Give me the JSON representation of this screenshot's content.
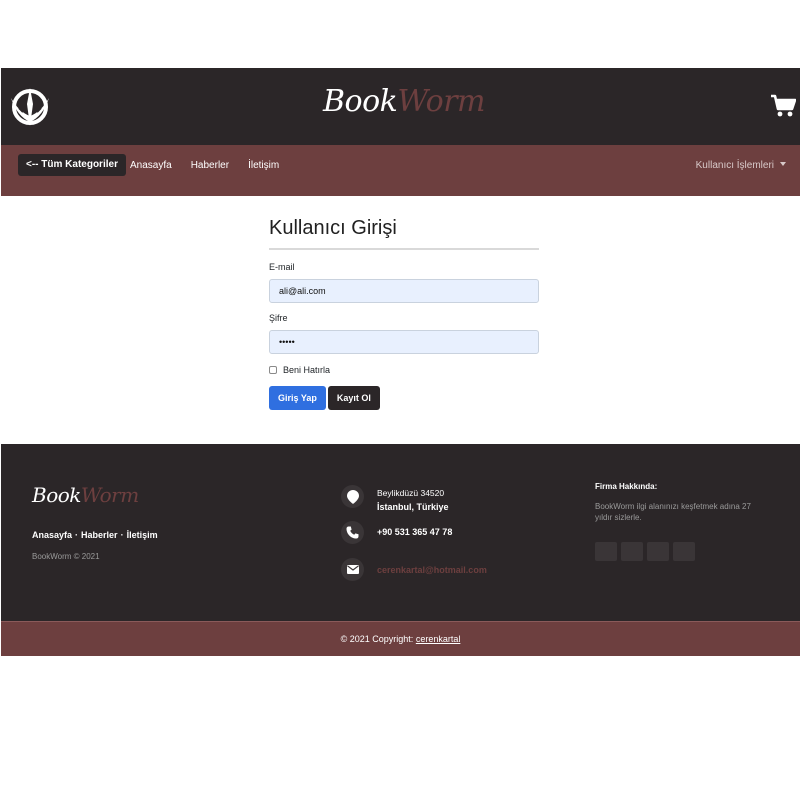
{
  "header": {
    "brand_part1": "Book",
    "brand_part2": "Worm",
    "logo_icon": "jedi-order-icon",
    "cart_icon": "shopping-cart-icon"
  },
  "navbar": {
    "all_categories_label": "<-- Tüm Kategoriler",
    "links": [
      "Anasayfa",
      "Haberler",
      "İletişim"
    ],
    "user_menu_label": "Kullanıcı İşlemleri"
  },
  "login": {
    "title": "Kullanıcı Girişi",
    "email_label": "E-mail",
    "email_value": "ali@ali.com",
    "password_label": "Şifre",
    "password_value": "•••••",
    "remember_label": "Beni Hatırla",
    "login_button": "Giriş Yap",
    "register_button": "Kayıt Ol"
  },
  "footer": {
    "brand_part1": "Book",
    "brand_part2": "Worm",
    "links": [
      "Anasayfa",
      "Haberler",
      "İletişim"
    ],
    "separator": "·",
    "copyright": "BookWorm © 2021",
    "address_line1": "Beylikdüzü 34520",
    "address_line2": "İstanbul, Türkiye",
    "phone": "+90 531 365 47 78",
    "email": "cerenkartal@hotmail.com",
    "about_title": "Firma Hakkında:",
    "about_text": "BookWorm ilgi alanınızı keşfetmek adına 27 yıldır sizlerle.",
    "bottom_prefix": "© 2021 Copyright:",
    "bottom_link": "cerenkartal"
  },
  "colors": {
    "dark": "#2b2628",
    "accent": "#6d3f3f",
    "primary_button": "#2f6fe0",
    "input_bg": "#e8f0fe"
  }
}
